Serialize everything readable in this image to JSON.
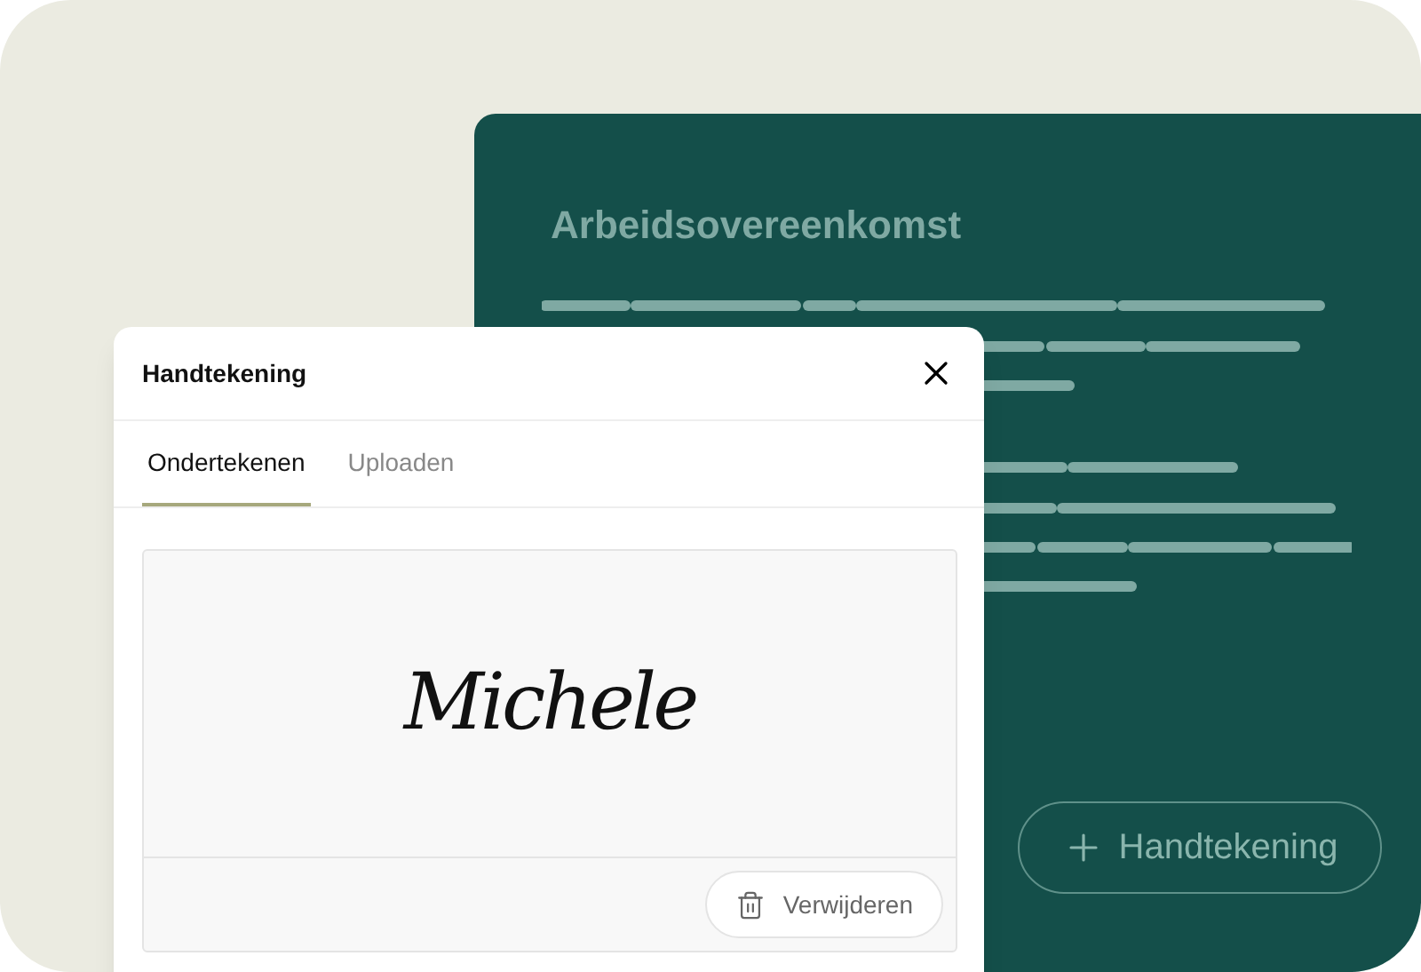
{
  "document": {
    "title": "Arbeidsovereenkomst",
    "add_button": {
      "label": "Handtekening"
    }
  },
  "dialog": {
    "title": "Handtekening",
    "tabs": [
      {
        "label": "Ondertekenen",
        "selected": true
      },
      {
        "label": "Uploaden",
        "selected": false
      }
    ],
    "signature": "Michele",
    "delete_button": {
      "label": "Verwijderen"
    }
  }
}
